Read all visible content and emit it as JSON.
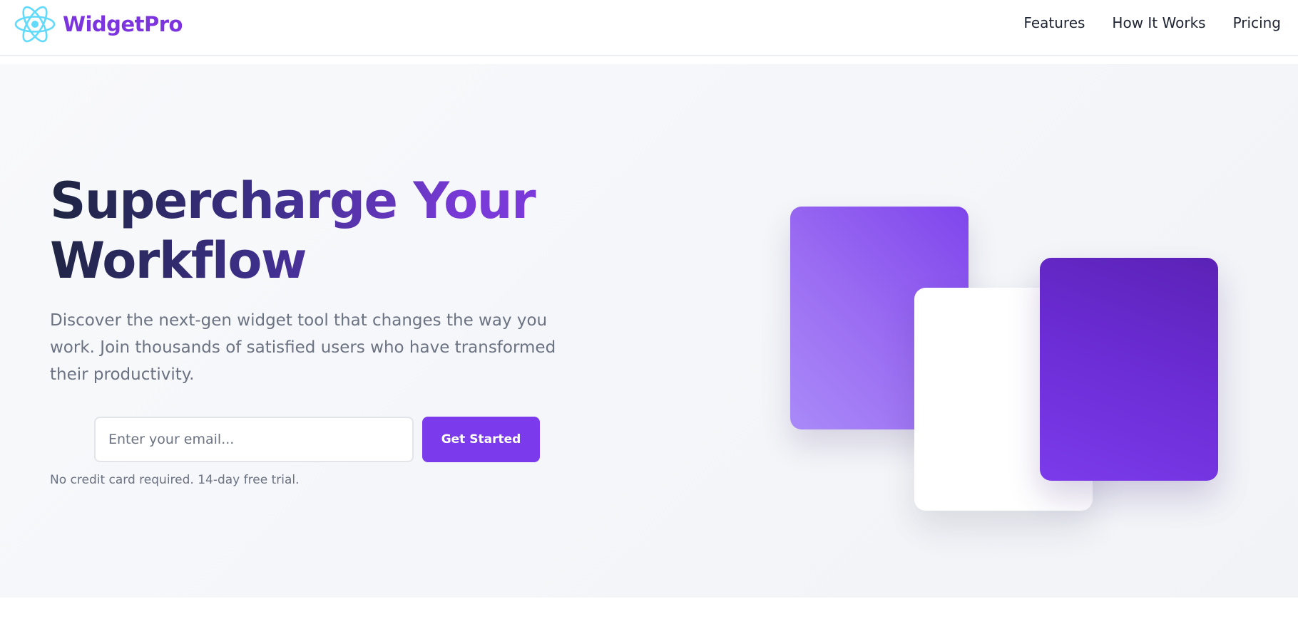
{
  "header": {
    "brand_name": "WidgetPro",
    "logo_icon": "atom-icon",
    "nav_links": [
      {
        "label": "Features"
      },
      {
        "label": "How It Works"
      },
      {
        "label": "Pricing"
      }
    ]
  },
  "hero": {
    "headline": "Supercharge Your Workflow",
    "description": "Discover the next-gen widget tool that changes the way you work. Join thousands of satisfied users who have transformed their productivity.",
    "email_placeholder": "Enter your email...",
    "cta_label": "Get Started",
    "fine_print": "No credit card required. 14-day free trial."
  },
  "colors": {
    "brand": "#7b34de",
    "accent": "#7c3aed",
    "logo": "#61dafb",
    "heading_dark": "#1e2540",
    "muted_text": "#6b7281"
  }
}
